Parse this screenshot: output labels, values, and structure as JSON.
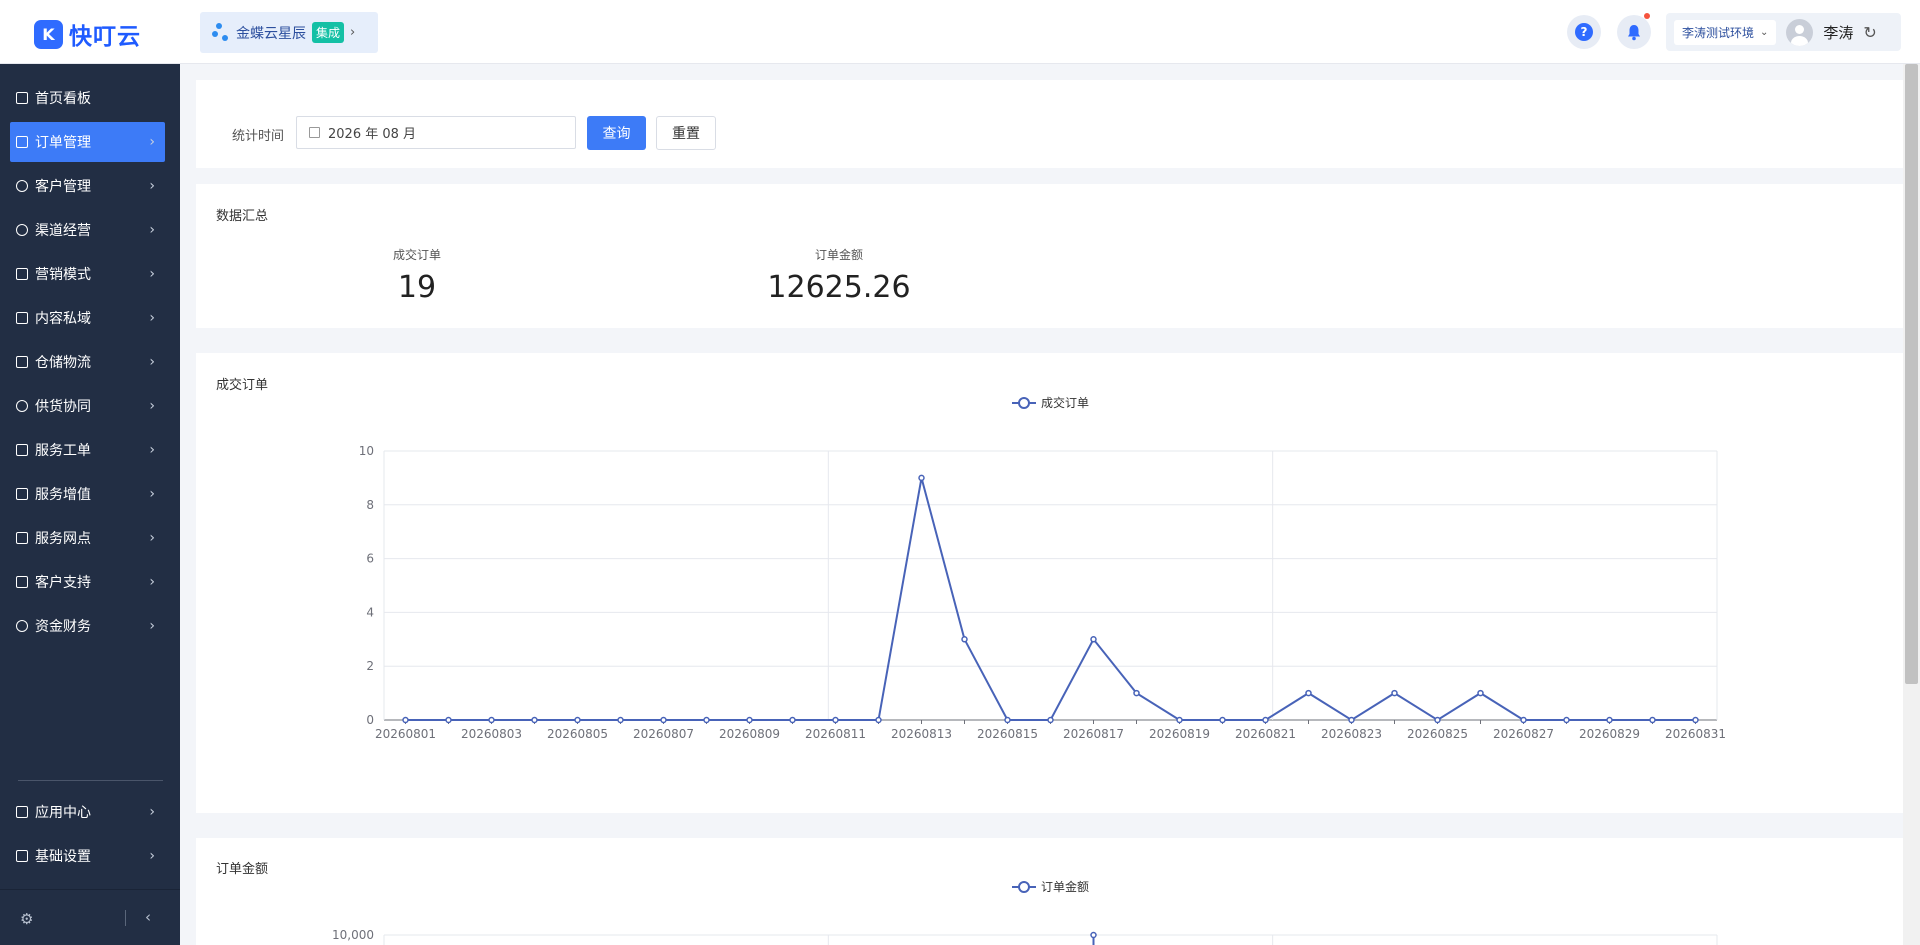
{
  "header": {
    "logo_mark": "K",
    "logo_text": "快叮云",
    "integration_name": "金蝶云星辰",
    "integration_badge": "集成",
    "help_symbol": "?",
    "env_label": "李涛测试环境",
    "username": "李涛"
  },
  "sidebar": {
    "items": [
      {
        "label": "首页看板",
        "icon": "home-icon"
      },
      {
        "label": "订单管理",
        "icon": "document-icon"
      },
      {
        "label": "客户管理",
        "icon": "user-icon"
      },
      {
        "label": "渠道经营",
        "icon": "channel-icon"
      },
      {
        "label": "营销模式",
        "icon": "tag-icon"
      },
      {
        "label": "内容私域",
        "icon": "image-icon"
      },
      {
        "label": "仓储物流",
        "icon": "box-icon"
      },
      {
        "label": "供货协同",
        "icon": "supplier-icon"
      },
      {
        "label": "服务工单",
        "icon": "ticket-icon"
      },
      {
        "label": "服务增值",
        "icon": "bag-icon"
      },
      {
        "label": "服务网点",
        "icon": "store-icon"
      },
      {
        "label": "客户支持",
        "icon": "support-icon"
      },
      {
        "label": "资金财务",
        "icon": "yuan-icon"
      }
    ],
    "bottom_items": [
      {
        "label": "应用中心",
        "icon": "cube-icon"
      },
      {
        "label": "基础设置",
        "icon": "settings-icon"
      }
    ]
  },
  "filter": {
    "label": "统计时间",
    "date_value": "2026 年 08 月",
    "query_button": "查询",
    "reset_button": "重置"
  },
  "summary": {
    "title": "数据汇总",
    "orders_label": "成交订单",
    "orders_value": "19",
    "amount_label": "订单金额",
    "amount_value": "12625.26"
  },
  "colors": {
    "primary": "#3d7bf7",
    "sidebar_bg": "#222e44",
    "series": "#4863b8"
  },
  "chart_data": [
    {
      "type": "line",
      "title": "成交订单",
      "series": [
        {
          "name": "成交订单",
          "values": [
            0,
            0,
            0,
            0,
            0,
            0,
            0,
            0,
            0,
            0,
            0,
            0,
            9,
            3,
            0,
            0,
            3,
            1,
            0,
            0,
            0,
            1,
            0,
            1,
            0,
            1,
            0,
            0,
            0,
            0,
            0
          ]
        }
      ],
      "x": [
        "20260801",
        "20260802",
        "20260803",
        "20260804",
        "20260805",
        "20260806",
        "20260807",
        "20260808",
        "20260809",
        "20260810",
        "20260811",
        "20260812",
        "20260813",
        "20260814",
        "20260815",
        "20260816",
        "20260817",
        "20260818",
        "20260819",
        "20260820",
        "20260821",
        "20260822",
        "20260823",
        "20260824",
        "20260825",
        "20260826",
        "20260827",
        "20260828",
        "20260829",
        "20260830",
        "20260831"
      ],
      "x_tick_labels": [
        "20260801",
        "20260803",
        "20260805",
        "20260807",
        "20260809",
        "20260811",
        "20260813",
        "20260815",
        "20260817",
        "20260819",
        "20260821",
        "20260823",
        "20260825",
        "20260827",
        "20260829",
        "20260831"
      ],
      "y_ticks": [
        "0",
        "2",
        "4",
        "6",
        "8",
        "10"
      ],
      "ylim": [
        0,
        10
      ],
      "legend": "top-center",
      "grid": true
    },
    {
      "type": "line",
      "title": "订单金额",
      "series": [
        {
          "name": "订单金额",
          "values": []
        }
      ],
      "y_ticks_visible": [
        "10,000"
      ],
      "ylim": [
        0,
        10000
      ],
      "legend": "top-center",
      "grid": true
    }
  ]
}
